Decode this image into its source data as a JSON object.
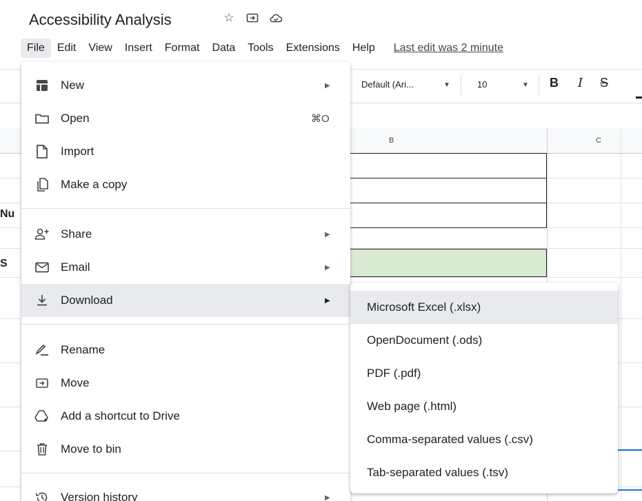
{
  "doc": {
    "title": "Accessibility Analysis",
    "icons": [
      "star-icon",
      "move-folder-icon",
      "cloud-status-icon"
    ]
  },
  "menubar": {
    "items": [
      "File",
      "Edit",
      "View",
      "Insert",
      "Format",
      "Data",
      "Tools",
      "Extensions",
      "Help"
    ],
    "active": "File",
    "last_edit": "Last edit was 2 minute"
  },
  "toolbar": {
    "font": "Default (Ari...",
    "font_size": "10",
    "bold": "B",
    "italic": "I",
    "strike": "S"
  },
  "sheet": {
    "columns": [
      "B",
      "C"
    ],
    "left_fragments": [
      "Nu",
      "S"
    ]
  },
  "file_menu": {
    "items": [
      {
        "label": "New",
        "icon": "new-sheet-icon",
        "submenu": true
      },
      {
        "label": "Open",
        "icon": "folder-icon",
        "shortcut": "⌘O"
      },
      {
        "label": "Import",
        "icon": "file-icon"
      },
      {
        "label": "Make a copy",
        "icon": "copy-icon"
      },
      {
        "label": "Share",
        "icon": "share-person-icon",
        "submenu": true
      },
      {
        "label": "Email",
        "icon": "email-icon",
        "submenu": true
      },
      {
        "label": "Download",
        "icon": "download-icon",
        "submenu": true,
        "highlighted": true
      },
      {
        "label": "Rename",
        "icon": "rename-icon"
      },
      {
        "label": "Move",
        "icon": "move-icon"
      },
      {
        "label": "Add a shortcut to Drive",
        "icon": "drive-shortcut-icon"
      },
      {
        "label": "Move to bin",
        "icon": "bin-icon"
      },
      {
        "label": "Version history",
        "icon": "history-icon",
        "submenu": true
      }
    ]
  },
  "download_menu": {
    "items": [
      {
        "label": "Microsoft Excel (.xlsx)",
        "highlighted": true
      },
      {
        "label": "OpenDocument (.ods)"
      },
      {
        "label": "PDF (.pdf)"
      },
      {
        "label": "Web page (.html)"
      },
      {
        "label": "Comma-separated values (.csv)"
      },
      {
        "label": "Tab-separated values (.tsv)"
      }
    ]
  },
  "colors": {
    "hover": "#e8eaed",
    "green_cell": "#d9ead3",
    "accent_blue": "#1a73e8"
  }
}
